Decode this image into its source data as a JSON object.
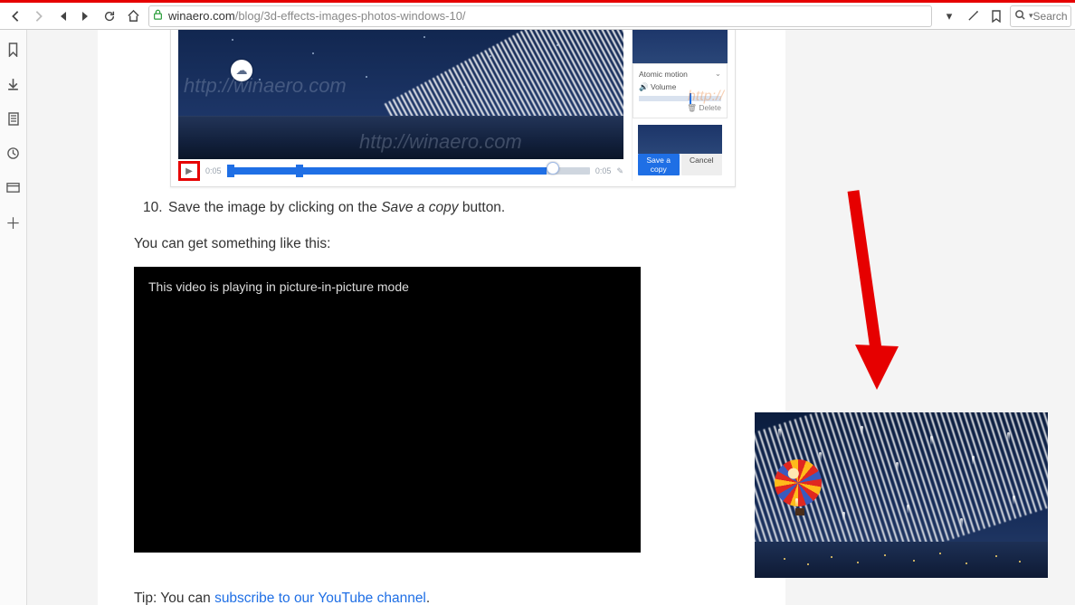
{
  "toolbar": {
    "url_host": "winaero.com",
    "url_path": "/blog/3d-effects-images-photos-windows-10/",
    "search_placeholder": "Search B"
  },
  "article": {
    "step_number": "10.",
    "step_text_a": "Save the image by clicking on the ",
    "step_italic": "Save a copy",
    "step_text_b": " button.",
    "result_text": "You can get something like this:",
    "pip_text": "This video is playing in picture-in-picture mode",
    "tip_prefix": "Tip: You can ",
    "tip_link": "subscribe to our YouTube channel",
    "tip_suffix": "."
  },
  "screenshot": {
    "watermark": "http://winaero.com",
    "play_time_start": "0:05",
    "play_time_end": "0:05",
    "side": {
      "effect": "Atomic motion",
      "volume_label": "Volume",
      "delete_label": "Delete",
      "save_btn": "Save a copy",
      "cancel_btn": "Cancel"
    }
  }
}
